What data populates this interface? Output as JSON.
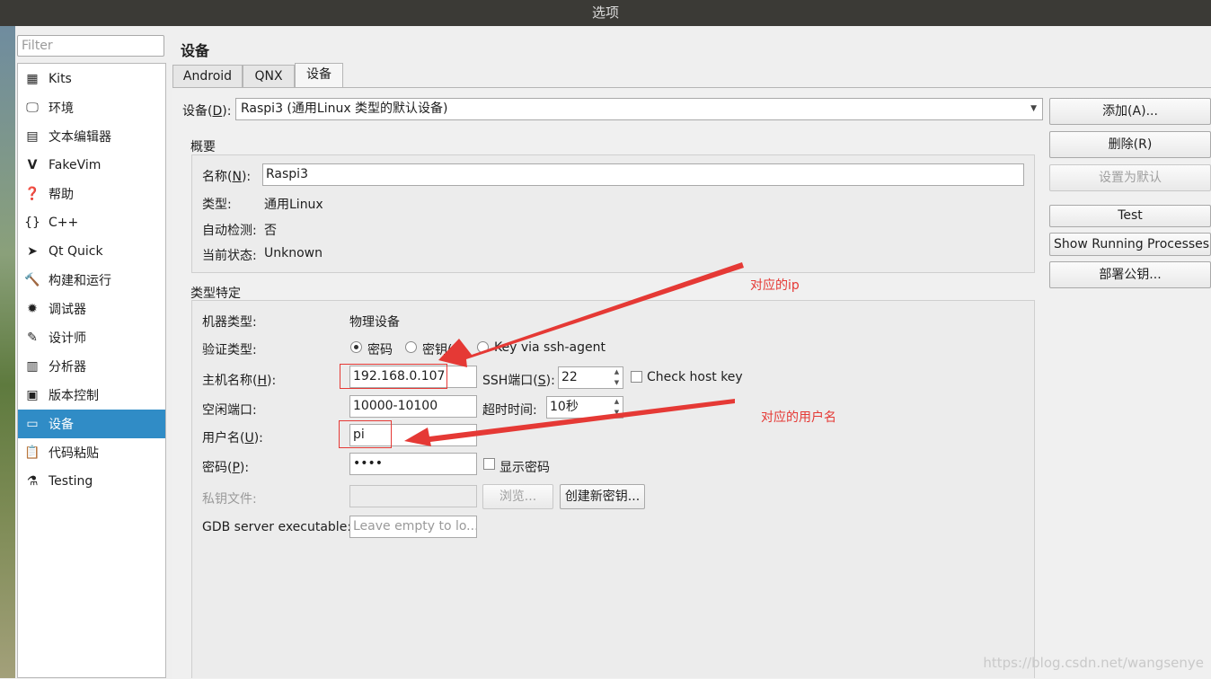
{
  "window": {
    "title": "选项"
  },
  "sidebar": {
    "filter_placeholder": "Filter",
    "items": [
      {
        "label": "Kits",
        "icon": "kits-icon"
      },
      {
        "label": "环境",
        "icon": "monitor-icon"
      },
      {
        "label": "文本编辑器",
        "icon": "text-editor-icon"
      },
      {
        "label": "FakeVim",
        "icon": "fakevim-icon"
      },
      {
        "label": "帮助",
        "icon": "help-icon"
      },
      {
        "label": "C++",
        "icon": "braces-icon"
      },
      {
        "label": "Qt Quick",
        "icon": "qt-quick-icon"
      },
      {
        "label": "构建和运行",
        "icon": "hammer-icon"
      },
      {
        "label": "调试器",
        "icon": "bug-icon"
      },
      {
        "label": "设计师",
        "icon": "pen-icon"
      },
      {
        "label": "分析器",
        "icon": "analyzer-icon"
      },
      {
        "label": "版本控制",
        "icon": "version-control-icon"
      },
      {
        "label": "设备",
        "icon": "device-icon",
        "selected": true
      },
      {
        "label": "代码粘贴",
        "icon": "code-paste-icon"
      },
      {
        "label": "Testing",
        "icon": "testing-icon"
      }
    ]
  },
  "main": {
    "page_title": "设备",
    "tabs": [
      "Android",
      "QNX",
      "设备"
    ],
    "active_tab": "设备",
    "device_label": "设备(",
    "device_label_key": "D",
    "device_label_end": "):",
    "device_value": "Raspi3 (通用Linux 类型的默认设备)",
    "overview": {
      "title": "概要",
      "name_label": "名称(",
      "name_key": "N",
      "name_end": "):",
      "name_value": "Raspi3",
      "type_label": "类型:",
      "type_value": "通用Linux",
      "autodetect_label": "自动检测:",
      "autodetect_value": "否",
      "state_label": "当前状态:",
      "state_value": "Unknown"
    },
    "specific": {
      "title": "类型特定",
      "machine_type_label": "机器类型:",
      "machine_type_value": "物理设备",
      "auth_label": "验证类型:",
      "auth_options": [
        "密码",
        "密钥(K)",
        "Key via ssh-agent"
      ],
      "auth_selected": "密码",
      "host_label": "主机名称(",
      "host_key": "H",
      "host_end": "):",
      "host_value": "192.168.0.107",
      "ssh_port_label": "SSH端口(",
      "ssh_port_key": "S",
      "ssh_port_end": "):",
      "ssh_port_value": "22",
      "check_host_key_label": "Check host key",
      "free_ports_label": "空闲端口:",
      "free_ports_value": "10000-10100",
      "timeout_label": "超时时间:",
      "timeout_value": "10秒",
      "user_label": "用户名(",
      "user_key": "U",
      "user_end": "):",
      "user_value": "pi",
      "password_label": "密码(",
      "password_key": "P",
      "password_end": "):",
      "password_value": "••••",
      "show_password_label": "显示密码",
      "private_key_label": "私钥文件:",
      "browse_label": "浏览...",
      "create_key_label": "创建新密钥...",
      "gdb_label": "GDB server executable:",
      "gdb_placeholder": "Leave empty to lo..."
    }
  },
  "buttons": {
    "add": "添加(A)...",
    "remove": "删除(R)",
    "set_default": "设置为默认",
    "test": "Test",
    "show_processes": "Show Running Processes...",
    "deploy_key": "部署公钥..."
  },
  "annotations": {
    "ip_note": "对应的ip",
    "user_note": "对应的用户名",
    "color": "#e53935"
  },
  "watermark": "https://blog.csdn.net/wangsenye"
}
